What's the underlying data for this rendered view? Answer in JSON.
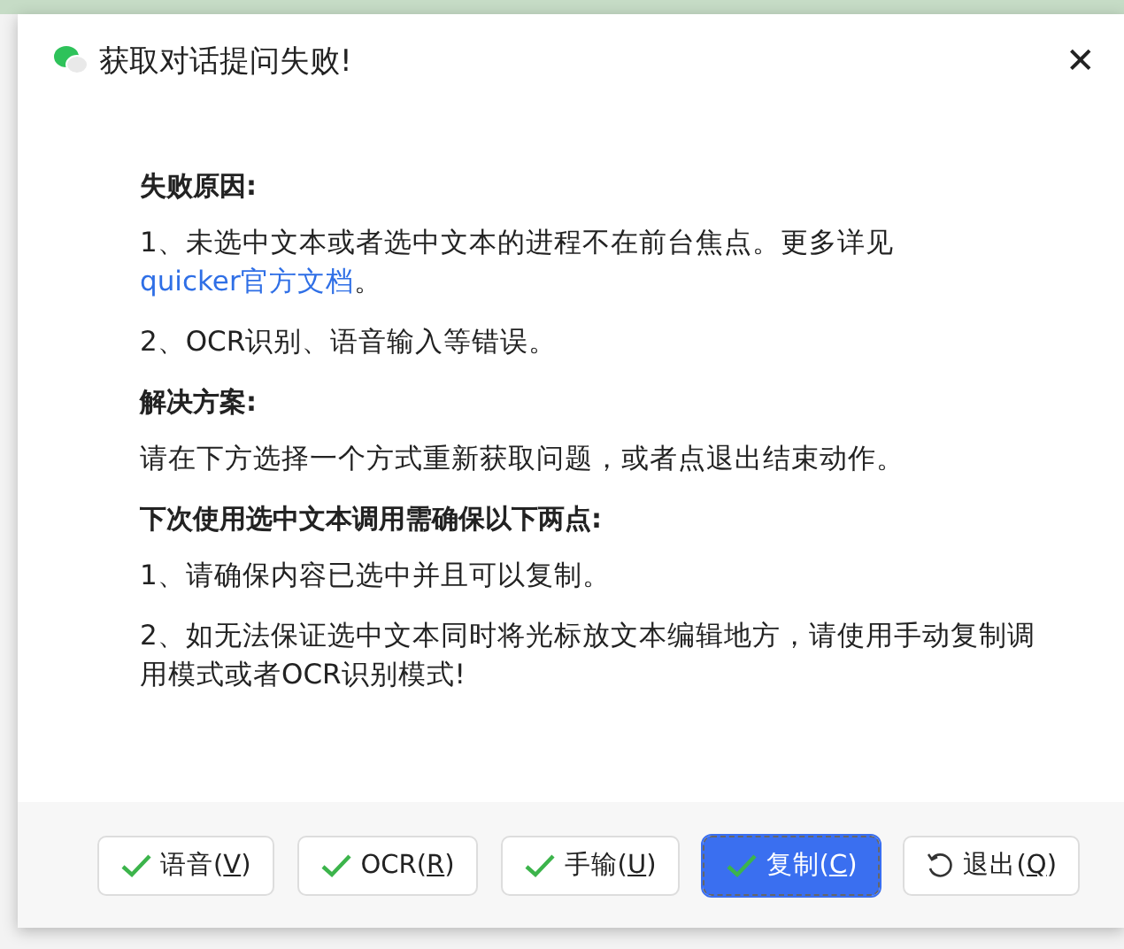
{
  "window": {
    "title": "获取对话提问失败!",
    "close": "✕"
  },
  "content": [
    {
      "kind": "heading",
      "text": "失败原因:"
    },
    {
      "kind": "paragraph",
      "text": "1、未选中文本或者选中文本的进程不在前台焦点。更多详见",
      "link": "quicker官方文档",
      "suffix": "。"
    },
    {
      "kind": "paragraph",
      "text": "2、OCR识别、语音输入等错误。"
    },
    {
      "kind": "heading",
      "text": "解决方案:"
    },
    {
      "kind": "paragraph",
      "text": "请在下方选择一个方式重新获取问题，或者点退出结束动作。"
    },
    {
      "kind": "heading",
      "text": "下次使用选中文本调用需确保以下两点:"
    },
    {
      "kind": "paragraph",
      "text": "1、请确保内容已选中并且可以复制。"
    },
    {
      "kind": "paragraph",
      "text": "2、如无法保证选中文本同时将光标放文本编辑地方，请使用手动复制调用模式或者OCR识别模式!"
    }
  ],
  "buttons": [
    {
      "kind": "check",
      "prefix": "语音(",
      "key": "V",
      "suffix": ")",
      "selected": false
    },
    {
      "kind": "check",
      "prefix": "OCR(",
      "key": "R",
      "suffix": ")",
      "selected": false
    },
    {
      "kind": "check",
      "prefix": "手输(",
      "key": "U",
      "suffix": ")",
      "selected": false
    },
    {
      "kind": "check",
      "prefix": "复制(",
      "key": "C",
      "suffix": ")",
      "selected": true
    },
    {
      "kind": "undo",
      "prefix": "退出(",
      "key": "Q",
      "suffix": ")",
      "selected": false
    }
  ]
}
